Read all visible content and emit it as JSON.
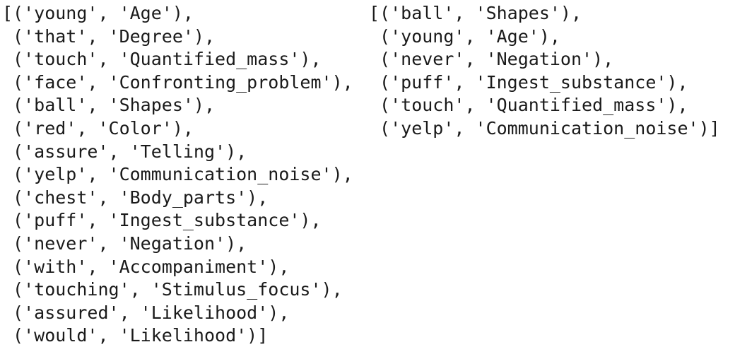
{
  "left_list": {
    "lines": [
      "[('young', 'Age'),",
      " ('that', 'Degree'),",
      " ('touch', 'Quantified_mass'),",
      " ('face', 'Confronting_problem'),",
      " ('ball', 'Shapes'),",
      " ('red', 'Color'),",
      " ('assure', 'Telling'),",
      " ('yelp', 'Communication_noise'),",
      " ('chest', 'Body_parts'),",
      " ('puff', 'Ingest_substance'),",
      " ('never', 'Negation'),",
      " ('with', 'Accompaniment'),",
      " ('touching', 'Stimulus_focus'),",
      " ('assured', 'Likelihood'),",
      " ('would', 'Likelihood')]"
    ]
  },
  "right_list": {
    "lines": [
      "[('ball', 'Shapes'),",
      " ('young', 'Age'),",
      " ('never', 'Negation'),",
      " ('puff', 'Ingest_substance'),",
      " ('touch', 'Quantified_mass'),",
      " ('yelp', 'Communication_noise')]"
    ]
  }
}
